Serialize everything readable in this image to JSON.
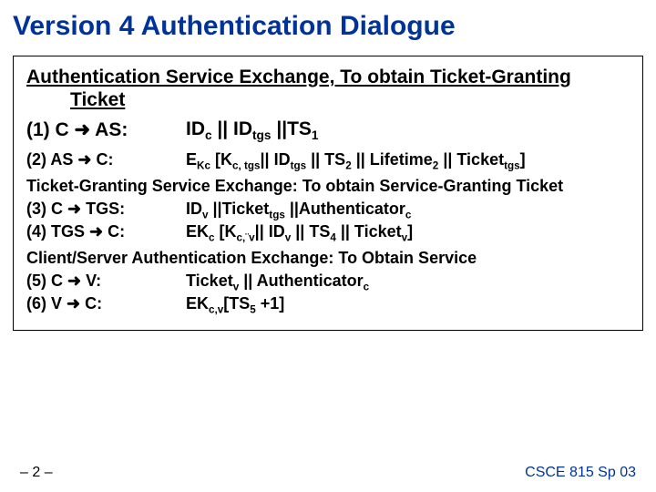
{
  "title": "Version 4 Authentication Dialogue",
  "section1": {
    "heading_l1": "Authentication Service Exchange, To obtain Ticket-Granting",
    "heading_l2": "Ticket"
  },
  "msg1": {
    "label_pre": "(1) C ",
    "label_post": " AS:",
    "arrow": "➜",
    "val_p1": "ID",
    "val_s1": "c",
    "val_p2": " || ID",
    "val_s2": "tgs",
    "val_p3": " ||TS",
    "val_s3": "1"
  },
  "msg2": {
    "label_pre": "(2)  AS ",
    "label_post": " C:",
    "arrow": "➜",
    "val_p1": "E",
    "val_s1": "Kc",
    "val_p2": " [K",
    "val_s2": "c, tgs",
    "val_p3": "|| ID",
    "val_s3": "tgs",
    "val_p4": " || TS",
    "val_s4": "2",
    "val_p5": " || Lifetime",
    "val_s5": "2",
    "val_p6": " || Ticket",
    "val_s6": "tgs",
    "val_p7": "]"
  },
  "section2": "Ticket-Granting Service Exchange: To obtain Service-Granting Ticket",
  "msg3": {
    "label_pre": "(3)  C ",
    "label_post": " TGS:",
    "arrow": "➜",
    "val_p1": "ID",
    "val_s1": "v",
    "val_p2": " ||Ticket",
    "val_s2": "tgs",
    "val_p3": " ||Authenticator",
    "val_s3": "c"
  },
  "msg4": {
    "label_pre": "(4)    TGS ",
    "label_post": " C:",
    "arrow": "➜",
    "val_p1": "EK",
    "val_s1": "c",
    "val_p2": " [K",
    "val_s2": "c,¨v",
    "val_p3": "|| ID",
    "val_s3": "v",
    "val_p4": " || TS",
    "val_s4": "4",
    "val_p5": " || Ticket",
    "val_s5": "v",
    "val_p6": "]"
  },
  "section3": "Client/Server Authentication Exchange: To Obtain Service",
  "msg5": {
    "label_pre": "(5) C ",
    "label_post": " V:",
    "arrow": "➜",
    "val_p1": "Ticket",
    "val_s1": "v",
    "val_p2": " || Authenticator",
    "val_s2": "c"
  },
  "msg6": {
    "label_pre": "(6)  V ",
    "label_post": " C:",
    "arrow": "➜",
    "val_p1": "EK",
    "val_s1": "c,v",
    "val_p2": "[TS",
    "val_s2": "5",
    "val_p3": " +1]"
  },
  "footer": {
    "page": "– 2 –",
    "course": "CSCE 815 Sp 03"
  }
}
